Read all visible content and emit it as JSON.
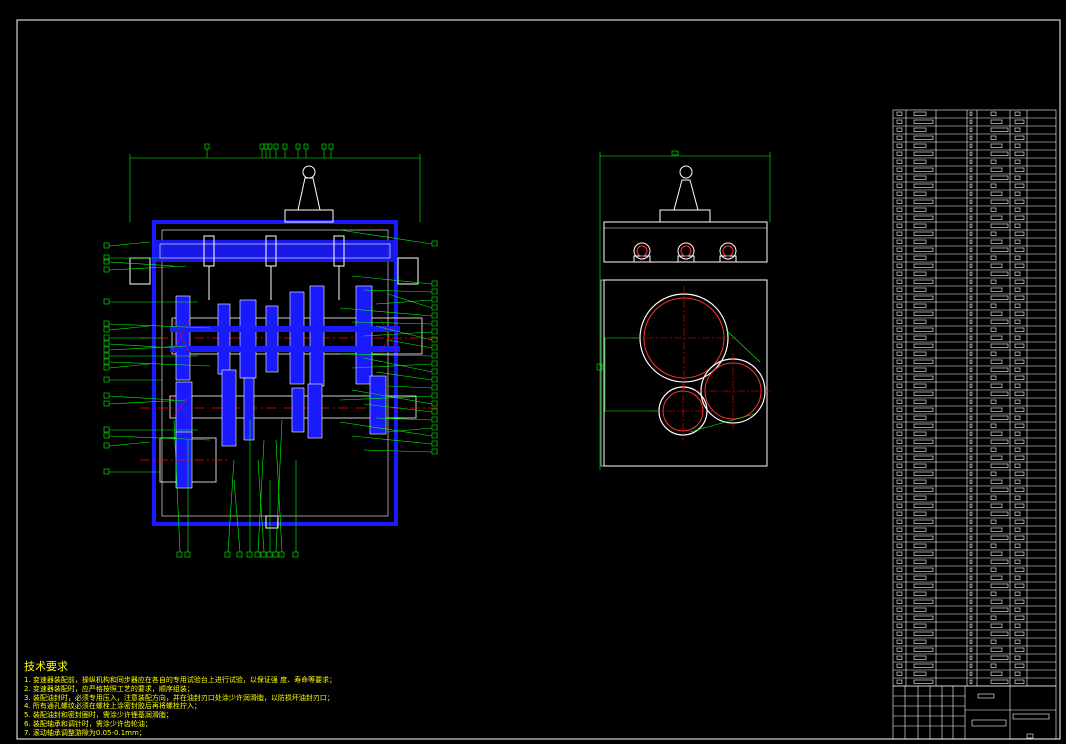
{
  "drawing": {
    "colors": {
      "background": "#000000",
      "frame": "#ffffff",
      "casing": "#1a1aff",
      "leader": "#00ff00",
      "centerline": "#ff0000",
      "notes": "#ffff00",
      "gear_outline": "#ff3333"
    },
    "technical_requirements": {
      "title": "技术要求",
      "lines": [
        "1. 变速器装配前，操纵机构和同步器应在各自的专用试验台上进行试验，以保证强    度、寿命等要求；",
        "2. 变速器装配时，应严格按照工艺的要求，顺序组装；",
        "3. 装配油封时，必须专用压入，注意装配方向，并在油封刃口处涂少许润滑脂，以防损坏油封刃口；",
        "4. 所有通孔螺纹必须在螺栓上涂密封胶后再将螺栓拧入；",
        "5. 装配油封和密封圈时，需涂少许锂基润滑脂；",
        "6. 装配轴承和调针时，需涂少许齿轮油；",
        "7. 滚动轴承调整游隙为0.05-0.1mm；"
      ]
    },
    "bom": {
      "rows": 72
    }
  }
}
